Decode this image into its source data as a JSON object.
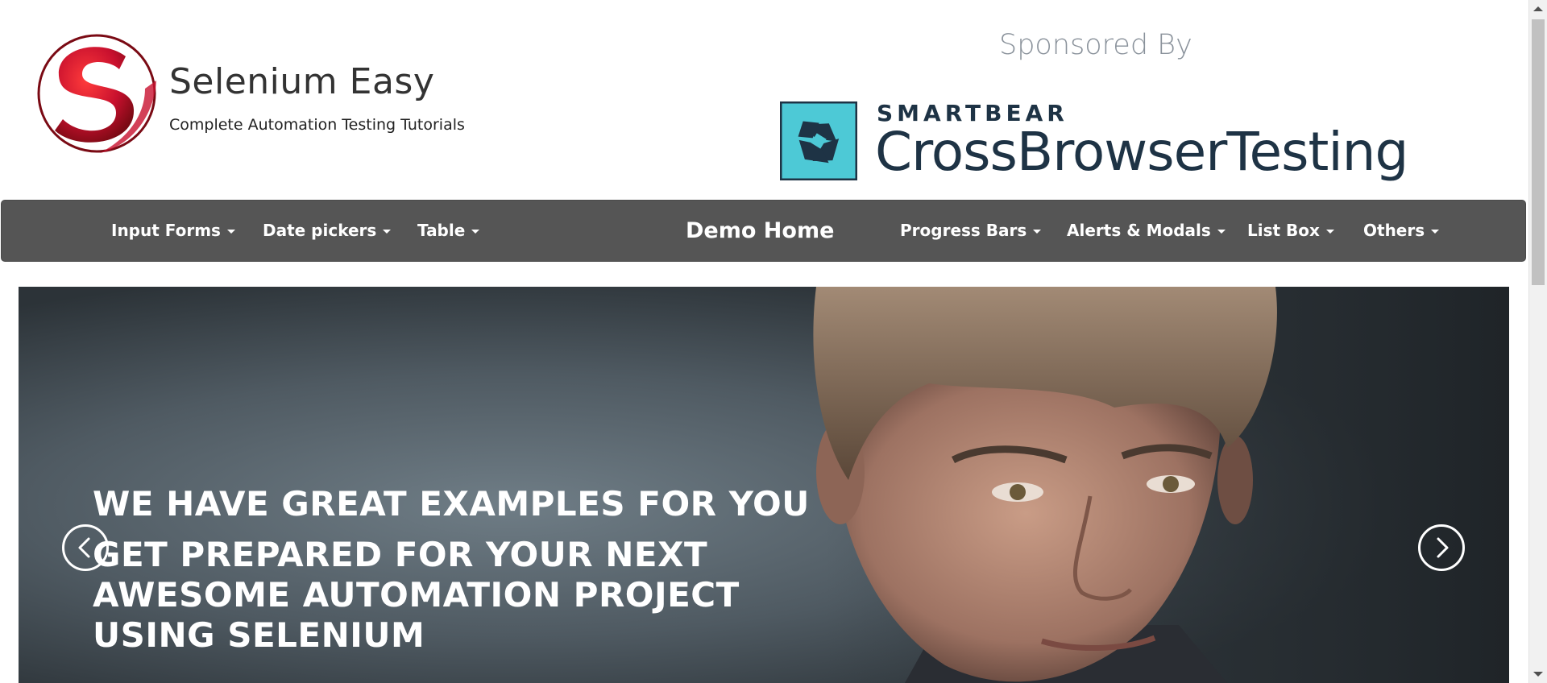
{
  "header": {
    "logo_title": "Selenium Easy",
    "logo_subtitle": "Complete Automation Testing Tutorials",
    "sponsor_label": "Sponsored By",
    "sponsor_brand": "SMARTBEAR",
    "sponsor_product": "CrossBrowserTesting"
  },
  "nav": {
    "brand": "Demo Home",
    "left_items": [
      {
        "label": "Input Forms"
      },
      {
        "label": "Date pickers"
      },
      {
        "label": "Table"
      }
    ],
    "right_items": [
      {
        "label": "Progress Bars"
      },
      {
        "label": "Alerts & Modals"
      },
      {
        "label": "List Box"
      },
      {
        "label": "Others"
      }
    ]
  },
  "carousel": {
    "caption_title": "WE HAVE GREAT EXAMPLES FOR YOU",
    "caption_text": "GET PREPARED FOR YOUR NEXT AWESOME AUTOMATION PROJECT USING SELENIUM",
    "prev_icon": "chevron-left-icon",
    "next_icon": "chevron-right-icon"
  },
  "colors": {
    "navbar": "#555555",
    "logo_red": "#c8102e",
    "sponsor_teal": "#4dc9d6",
    "sponsor_text": "#1e3345"
  }
}
